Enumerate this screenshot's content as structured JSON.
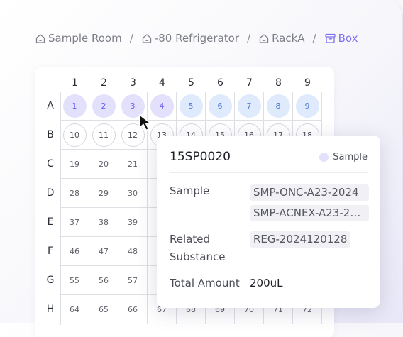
{
  "breadcrumb": {
    "items": [
      {
        "label": "Sample Room",
        "icon": "home-icon"
      },
      {
        "label": "-80 Refrigerator",
        "icon": "home-icon"
      },
      {
        "label": "RackA",
        "icon": "home-icon"
      },
      {
        "label": "Box",
        "icon": "box-icon"
      }
    ],
    "separator": "/"
  },
  "plate": {
    "columns": [
      "1",
      "2",
      "3",
      "4",
      "5",
      "6",
      "7",
      "8",
      "9"
    ],
    "rows": [
      "A",
      "B",
      "C",
      "D",
      "E",
      "F",
      "G",
      "H"
    ],
    "visible_wells": {
      "A": [
        "1",
        "2",
        "3",
        "4",
        "5",
        "6",
        "7",
        "8",
        "9"
      ],
      "B": [
        "10",
        "11",
        "12",
        "13",
        "14",
        "15",
        "16",
        "17",
        "18"
      ],
      "C": [
        "19",
        "20",
        "21"
      ],
      "D": [
        "28",
        "29",
        "30"
      ],
      "E": [
        "37",
        "38",
        "39"
      ],
      "F": [
        "46",
        "47",
        "48"
      ],
      "G": [
        "55",
        "56",
        "57"
      ],
      "H": [
        "64",
        "65",
        "66",
        "67",
        "68",
        "69",
        "70",
        "71",
        "72"
      ]
    },
    "well_styles": {
      "A": [
        "purple",
        "purple",
        "purple",
        "purple",
        "blue",
        "blue",
        "blue",
        "blue",
        "blue"
      ],
      "B": "empty"
    },
    "colors": {
      "purple": "#e3e0fb",
      "blue": "#dfeafc",
      "accent": "#7c70f0"
    }
  },
  "popup": {
    "title": "15SP0020",
    "badge": "Sample",
    "sample_label": "Sample",
    "sample_values": [
      "SMP-ONC-A23-2024",
      "SMP-ACNEX-A23-20..."
    ],
    "related_label_line1": "Related",
    "related_label_line2": "Substance",
    "related_value": "REG-2024120128",
    "amount_label": "Total Amount",
    "amount_value": "200uL"
  }
}
